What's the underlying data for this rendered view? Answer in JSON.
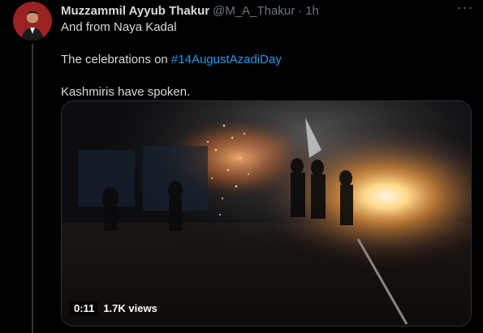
{
  "tweet": {
    "author_name": "Muzzammil Ayyub Thakur",
    "handle": "@M_A_Thakur",
    "separator": "·",
    "time": "1h",
    "more_icon": "more-horizontal-icon",
    "line1": "And from Naya Kadal",
    "line2_prefix": "The celebrations on ",
    "hashtag": "#14AugustAzadiDay",
    "line3": "Kashmiris have spoken."
  },
  "media": {
    "duration": "0:11",
    "views": "1.7K views"
  },
  "colors": {
    "background": "#000000",
    "text": "#d9d9d9",
    "muted": "#6e767d",
    "link": "#1d9bf0",
    "avatar_bg": "#8a1a1a"
  }
}
